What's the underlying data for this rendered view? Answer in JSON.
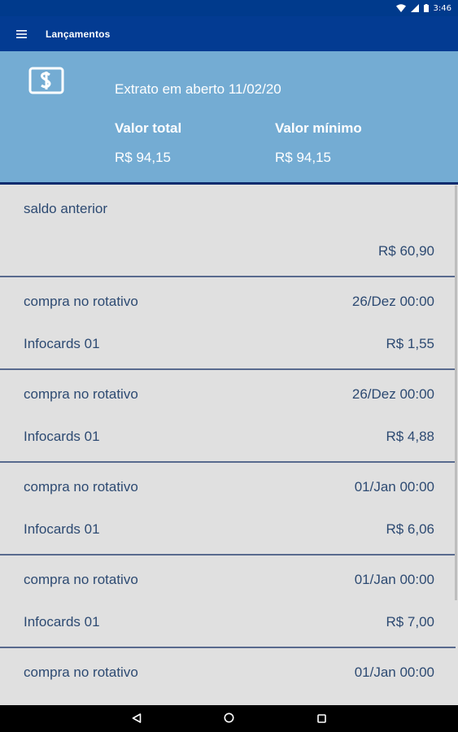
{
  "status_bar": {
    "time": "3:46"
  },
  "app_bar": {
    "title": "Lançamentos"
  },
  "summary": {
    "extrato": "Extrato em aberto 11/02/20",
    "total_label": "Valor total",
    "total_value": "R$ 94,15",
    "minimo_label": "Valor mínimo",
    "minimo_value": "R$ 94,15"
  },
  "entries": [
    {
      "description": "saldo anterior",
      "date": "",
      "merchant": "",
      "amount": "R$ 60,90"
    },
    {
      "description": "compra no rotativo",
      "date": "26/Dez 00:00",
      "merchant": "Infocards 01",
      "amount": "R$ 1,55"
    },
    {
      "description": "compra no rotativo",
      "date": "26/Dez 00:00",
      "merchant": "Infocards 01",
      "amount": "R$ 4,88"
    },
    {
      "description": "compra no rotativo",
      "date": "01/Jan 00:00",
      "merchant": "Infocards 01",
      "amount": "R$ 6,06"
    },
    {
      "description": "compra no rotativo",
      "date": "01/Jan 00:00",
      "merchant": "Infocards 01",
      "amount": "R$ 7,00"
    },
    {
      "description": "compra no rotativo",
      "date": "01/Jan 00:00",
      "merchant": "",
      "amount": ""
    }
  ],
  "icons": {
    "menu": "hamburger-menu-icon",
    "money": "dollar-bill-icon",
    "back": "back-triangle-icon",
    "home": "home-circle-icon",
    "recents": "recents-square-icon"
  },
  "colors": {
    "app_bar": "#033b92",
    "summary_bg": "#74acd3",
    "list_bg": "#e0e0e0",
    "list_text": "#2d4a72"
  }
}
